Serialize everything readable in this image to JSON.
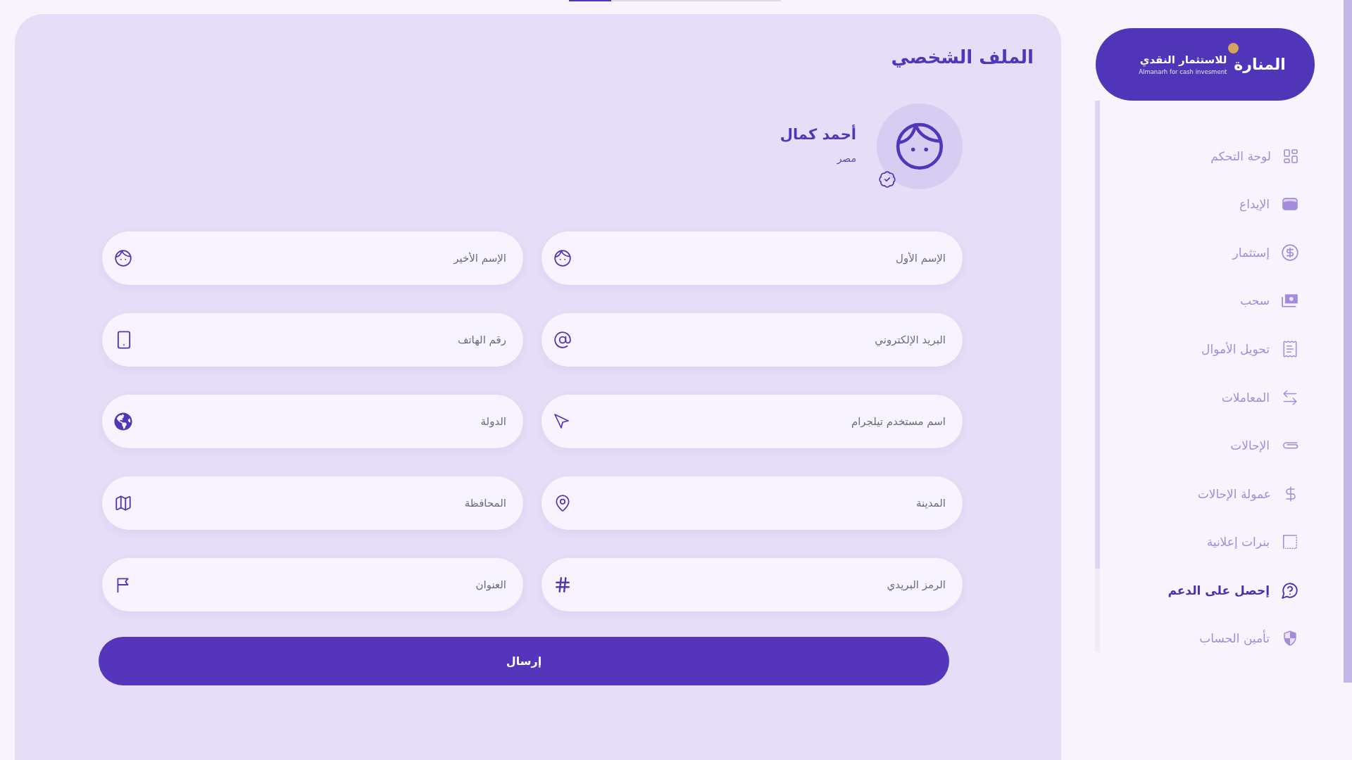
{
  "progress_bar": {
    "level": 0.2
  },
  "sidebar": {
    "logo": {
      "mark": "المنارة",
      "title": "للاستثمار النقدي",
      "subtitle": "Almanarh for cash invesment"
    },
    "items": [
      {
        "label": "لوحة التحكم",
        "selected": false
      },
      {
        "label": "الإيداع",
        "selected": false
      },
      {
        "label": "إستثمار",
        "selected": false
      },
      {
        "label": "سحب",
        "selected": false
      },
      {
        "label": "تحويل الأموال",
        "selected": false
      },
      {
        "label": "المعاملات",
        "selected": false
      },
      {
        "label": "الإحالات",
        "selected": false
      },
      {
        "label": "عمولة الإحالات",
        "selected": false
      },
      {
        "label": "بنرات إعلانية",
        "selected": false
      },
      {
        "label": "إحصل على الدعم",
        "selected": true
      },
      {
        "label": "تأمين الحساب",
        "selected": false
      }
    ]
  },
  "main": {
    "title": "الملف الشخصي",
    "profile": {
      "name": "أحمد كمال",
      "country": "مصر",
      "verified": true
    },
    "fields": [
      {
        "placeholder": "الإسم الأول"
      },
      {
        "placeholder": "الإسم الأخير"
      },
      {
        "placeholder": "البريد الإلكتروني"
      },
      {
        "placeholder": "رقم الهاتف"
      },
      {
        "placeholder": "اسم مستخدم تيلجرام"
      },
      {
        "placeholder": "الدولة"
      },
      {
        "placeholder": "المدينة"
      },
      {
        "placeholder": "المحافظة"
      },
      {
        "placeholder": "الرمز البريدي"
      },
      {
        "placeholder": "العنوان"
      }
    ],
    "submit_button": "إرسال"
  }
}
